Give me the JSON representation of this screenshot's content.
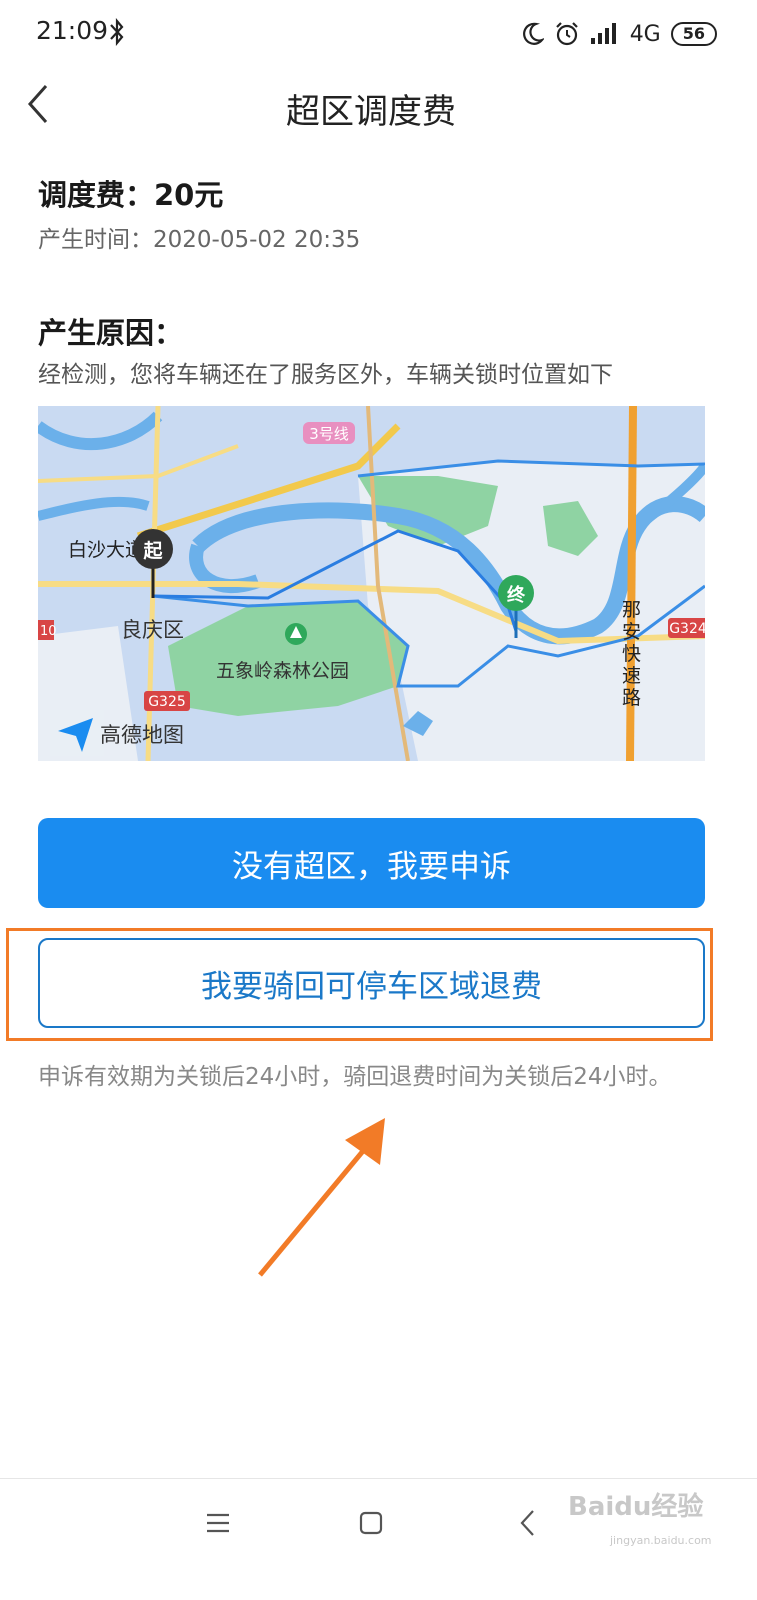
{
  "status_bar": {
    "time": "21:09",
    "network": "4G",
    "battery": "56",
    "icons": [
      "bluetooth-icon",
      "moon-icon",
      "alarm-icon",
      "signal-icon"
    ]
  },
  "header": {
    "title": "超区调度费",
    "back_icon": "back-arrow-icon"
  },
  "fee": {
    "text": "调度费：20元",
    "time_text": "产生时间：2020-05-02 20:35"
  },
  "reason": {
    "title": "产生原因：",
    "description": "经检测，您将车辆还在了服务区外，车辆关锁时位置如下"
  },
  "map": {
    "start_marker": "起",
    "end_marker": "终",
    "labels": {
      "baisha": "白沙大道",
      "liangqing": "良庆区",
      "park": "五象岭森林公园",
      "line3": "3号线",
      "g325": "G325",
      "g324": "G324",
      "road_num_left": "10",
      "naan_1": "那",
      "naan_2": "安",
      "naan_3": "快",
      "naan_4": "速",
      "naan_5": "路"
    },
    "logo_text": "高德地图",
    "colors": {
      "water": "#6bb0ea",
      "zone": "#3a8ee6",
      "park": "#8fd3a3",
      "road": "#f2c94c"
    }
  },
  "actions": {
    "appeal_button": "没有超区，我要申诉",
    "refund_button": "我要骑回可停车区域退费"
  },
  "note": "申诉有效期为关锁后24小时，骑回退费时间为关锁后24小时。",
  "watermark": {
    "text": "Baidu经验",
    "sub": "jingyan.baidu.com"
  },
  "colors": {
    "primary": "#1a8cf0",
    "highlight": "#f27b27"
  }
}
